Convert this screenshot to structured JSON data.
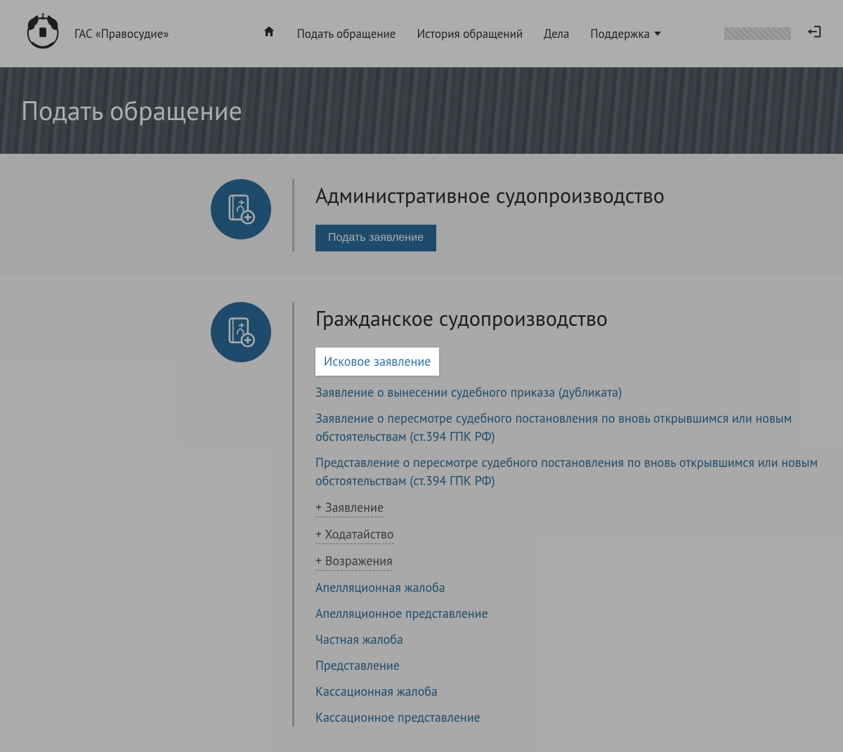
{
  "header": {
    "site_name": "ГАС «Правосудие»",
    "nav": {
      "home_aria": "Домой",
      "submit": "Подать обращение",
      "history": "История обращений",
      "cases": "Дела",
      "support": "Поддержка"
    },
    "logout_aria": "Выйти"
  },
  "hero": {
    "title": "Подать обращение"
  },
  "sections": {
    "admin": {
      "title": "Административное судопроизводство",
      "button": "Подать заявление"
    },
    "civil": {
      "title": "Гражданское судопроизводство",
      "highlight": "Исковое заявление",
      "links": [
        "Заявление о вынесении судебного приказа (дубликата)",
        "Заявление о пересмотре судебного постановления по вновь открывшимся или новым обстоятельствам (ст.394 ГПК РФ)",
        "Представление о пересмотре судебного постановления по вновь открывшимся или новым обстоятельствам (ст.394 ГПК РФ)"
      ],
      "expandables": [
        "+  Заявление",
        "+  Ходатайство",
        "+  Возражения"
      ],
      "more_links": [
        "Апелляционная жалоба",
        "Апелляционное представление",
        "Частная жалоба",
        "Представление",
        "Кассационная жалоба",
        "Кассационное представление"
      ]
    }
  }
}
